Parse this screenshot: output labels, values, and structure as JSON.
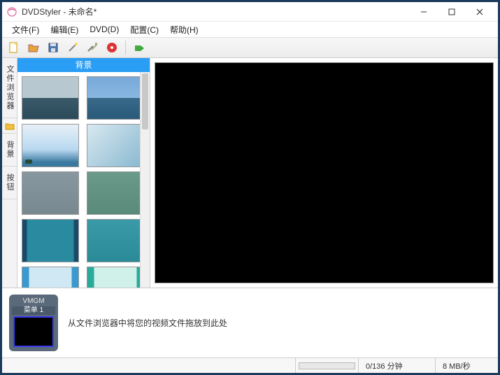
{
  "window": {
    "title": "DVDStyler - 未命名*"
  },
  "menu": {
    "file": "文件(F)",
    "edit": "编辑(E)",
    "dvd": "DVD(D)",
    "config": "配置(C)",
    "help": "帮助(H)"
  },
  "toolbar": {
    "icons": [
      "new",
      "open",
      "save",
      "wizard",
      "settings",
      "burn",
      "sep",
      "run"
    ]
  },
  "sidebar": {
    "tabs": [
      {
        "label": "文件浏览器",
        "icon": "folder"
      },
      {
        "label": "背景",
        "icon": null
      },
      {
        "label": "按钮",
        "icon": null
      }
    ]
  },
  "gallery": {
    "header": "背景",
    "thumbs": [
      "t-ocean1",
      "t-ocean2",
      "t-sky1",
      "t-sky2",
      "t-blur1",
      "t-blur2",
      "t-teal1",
      "t-teal2",
      "t-lb1",
      "t-lb2"
    ]
  },
  "timeline": {
    "thumb_head": "VMGM",
    "thumb_sub": "菜单 1",
    "hint": "从文件浏览器中将您的视频文件拖放到此处"
  },
  "status": {
    "time": "0/136 分钟",
    "rate": "8 MB/秒"
  }
}
